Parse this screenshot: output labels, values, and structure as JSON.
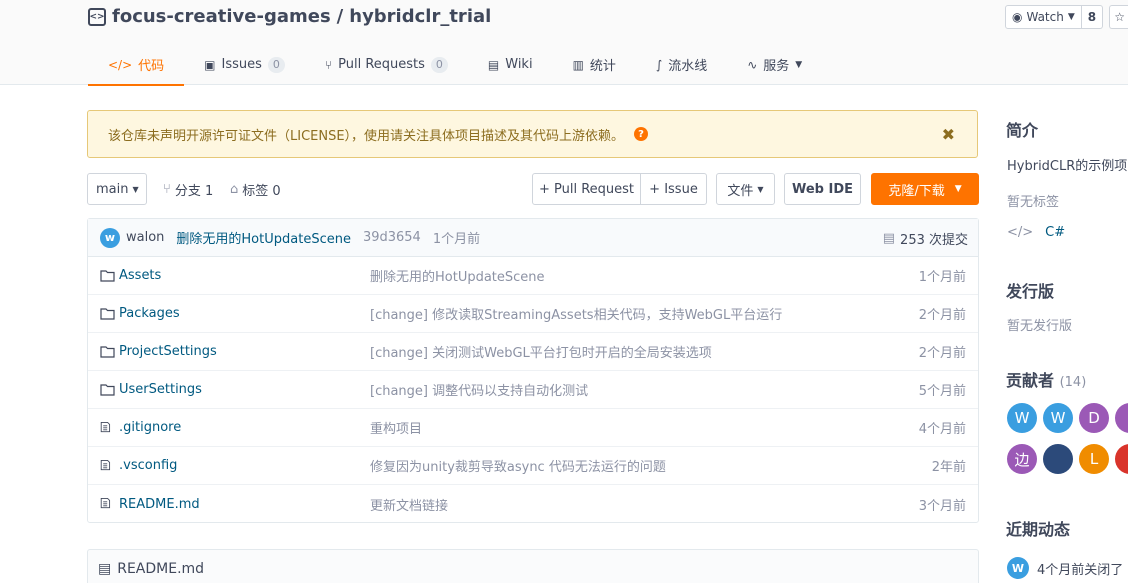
{
  "repo": {
    "owner": "focus-creative-games",
    "separator": "/",
    "name": "hybridclr_trial"
  },
  "watch": {
    "label": "Watch",
    "count": "8"
  },
  "tabs": [
    {
      "label": "代码",
      "icon": "code-icon",
      "active": true
    },
    {
      "label": "Issues",
      "badge": "0",
      "icon": "issue-icon"
    },
    {
      "label": "Pull Requests",
      "badge": "0",
      "icon": "pull-request-icon"
    },
    {
      "label": "Wiki",
      "icon": "wiki-icon"
    },
    {
      "label": "统计",
      "icon": "stats-icon"
    },
    {
      "label": "流水线",
      "icon": "pipeline-icon"
    },
    {
      "label": "服务",
      "icon": "service-icon"
    }
  ],
  "notice": {
    "text": "该仓库未声明开源许可证文件（LICENSE），使用请关注具体项目描述及其代码上游依赖。",
    "help": "?",
    "close": "✖"
  },
  "toolbar": {
    "branch": "main",
    "branches": "分支 1",
    "tags": "标签 0",
    "pull_request": "+ Pull Request",
    "issue": "+ Issue",
    "file": "文件",
    "web_ide": "Web IDE",
    "clone": "克隆/下载"
  },
  "commit": {
    "avatar": "w",
    "author": "walon",
    "message": "删除无用的HotUpdateScene",
    "sha": "39d3654",
    "time": "1个月前",
    "count": "253 次提交"
  },
  "files": [
    {
      "type": "folder",
      "name": "Assets",
      "message": "删除无用的HotUpdateScene",
      "time": "1个月前"
    },
    {
      "type": "folder",
      "name": "Packages",
      "message": "[change] 修改读取StreamingAssets相关代码，支持WebGL平台运行",
      "time": "2个月前"
    },
    {
      "type": "folder",
      "name": "ProjectSettings",
      "message": "[change] 关闭测试WebGL平台打包时开启的全局安装选项",
      "time": "2个月前"
    },
    {
      "type": "folder",
      "name": "UserSettings",
      "message": "[change] 调整代码以支持自动化测试",
      "time": "5个月前"
    },
    {
      "type": "file",
      "name": ".gitignore",
      "message": "重构项目",
      "time": "4个月前"
    },
    {
      "type": "file",
      "name": ".vsconfig",
      "message": "修复因为unity裁剪导致async 代码无法运行的问题",
      "time": "2年前"
    },
    {
      "type": "file",
      "name": "README.md",
      "message": "更新文档链接",
      "time": "3个月前"
    }
  ],
  "readme": {
    "title": "README.md"
  },
  "sidebar": {
    "intro_title": "简介",
    "intro_text": "HybridCLR的示例项",
    "no_tags": "暂无标签",
    "language": "C#",
    "release_title": "发行版",
    "no_release": "暂无发行版",
    "contributors_title": "贡献者",
    "contributors_count": "(14)",
    "contributors": [
      {
        "initial": "W",
        "color": "#3a9ee0"
      },
      {
        "initial": "W",
        "color": "#3a9ee0"
      },
      {
        "initial": "D",
        "color": "#9b59b6"
      },
      {
        "initial": "",
        "color": "#9b59b6"
      },
      {
        "initial": "边",
        "color": "#9b59b6"
      },
      {
        "initial": "",
        "color": "#2c4a7a"
      },
      {
        "initial": "L",
        "color": "#f08c00"
      },
      {
        "initial": "",
        "color": "#d9342b"
      }
    ],
    "activity_title": "近期动态",
    "activity_avatar": "W",
    "activity_text": "4个月前关闭了"
  },
  "colors": {
    "accent": "#fe7300",
    "link": "#005980"
  }
}
